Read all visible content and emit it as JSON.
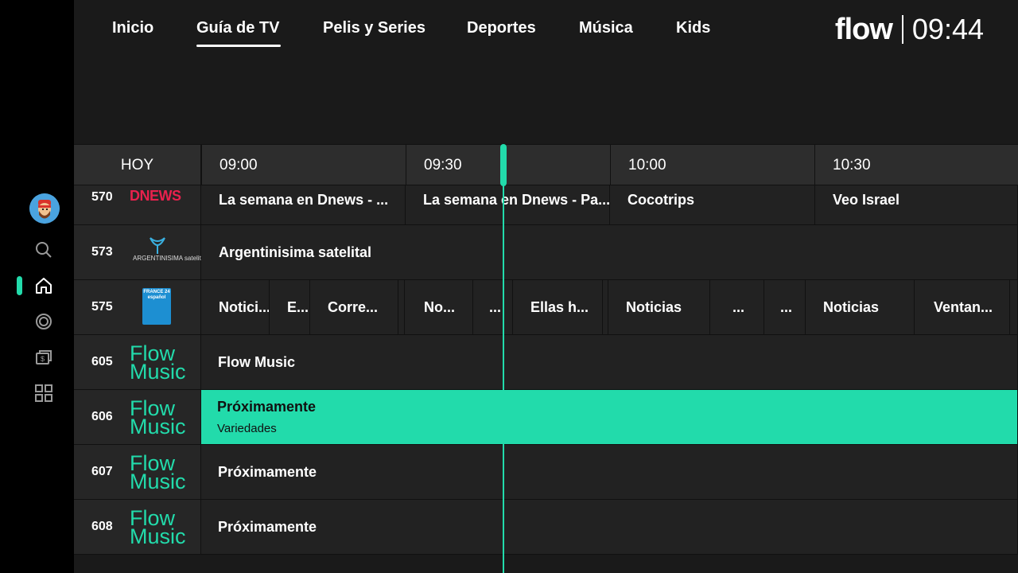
{
  "nav": {
    "tabs": [
      {
        "label": "Inicio"
      },
      {
        "label": "Guía de TV"
      },
      {
        "label": "Pelis y Series"
      },
      {
        "label": "Deportes"
      },
      {
        "label": "Música"
      },
      {
        "label": "Kids"
      }
    ],
    "active_tab": "Guía de TV",
    "brand": "flow",
    "clock": "09:44"
  },
  "guide": {
    "day_label": "HOY",
    "times": [
      "09:00",
      "09:30",
      "10:00",
      "10:30"
    ],
    "now_time": "09:44",
    "channels": [
      {
        "number": "570",
        "logo_text": "DNEWS",
        "programs": [
          {
            "title": "La semana en Dnews - ..."
          },
          {
            "title": "La semana en Dnews - Pa..."
          },
          {
            "title": "Cocotrips"
          },
          {
            "title": "Veo Israel"
          }
        ]
      },
      {
        "number": "573",
        "logo_text": "ARGENTINISIMA satelital",
        "programs": [
          {
            "title": "Argentinisima satelital"
          }
        ]
      },
      {
        "number": "575",
        "logo_text": "FRANCE 24 español",
        "programs": [
          {
            "title": "Notici..."
          },
          {
            "title": "E..."
          },
          {
            "title": "Corre..."
          },
          {
            "title": ""
          },
          {
            "title": "No..."
          },
          {
            "title": "..."
          },
          {
            "title": "Ellas h..."
          },
          {
            "title": "Noticias"
          },
          {
            "title": "..."
          },
          {
            "title": "..."
          },
          {
            "title": "Noticias"
          },
          {
            "title": "Ventan..."
          }
        ]
      },
      {
        "number": "605",
        "logo_text": [
          "Flow",
          "Music"
        ],
        "programs": [
          {
            "title": "Flow Music"
          }
        ]
      },
      {
        "number": "606",
        "logo_text": [
          "Flow",
          "Music"
        ],
        "programs": [
          {
            "title": "Próximamente",
            "subtitle": "Variedades",
            "selected": true
          }
        ]
      },
      {
        "number": "607",
        "logo_text": [
          "Flow",
          "Music"
        ],
        "programs": [
          {
            "title": "Próximamente"
          }
        ]
      },
      {
        "number": "608",
        "logo_text": [
          "Flow",
          "Music"
        ],
        "programs": [
          {
            "title": "Próximamente"
          }
        ]
      }
    ]
  },
  "sidebar": {
    "items": [
      {
        "icon": "avatar"
      },
      {
        "icon": "search-icon"
      },
      {
        "icon": "home-icon",
        "active": true
      },
      {
        "icon": "live-icon"
      },
      {
        "icon": "store-icon"
      },
      {
        "icon": "apps-icon"
      }
    ]
  },
  "colors": {
    "accent": "#22dbab",
    "background": "#1a1a1a",
    "sidebar": "#000000"
  }
}
